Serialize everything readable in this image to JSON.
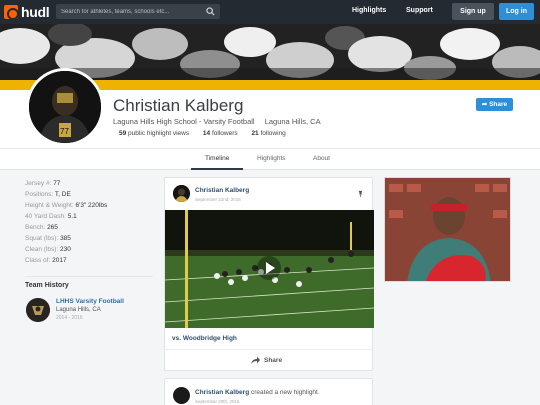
{
  "nav": {
    "logo_text": "hudl",
    "search_placeholder": "Search for athletes, teams, schools etc...",
    "links": [
      "Highlights",
      "Support"
    ],
    "signup_label": "Sign up",
    "login_label": "Log in",
    "brand_color": "#ff6300"
  },
  "profile": {
    "name": "Christian Kalberg",
    "school": "Laguna Hills High School - Varsity Football",
    "location": "Laguna Hills, CA",
    "stats": [
      {
        "value": "59",
        "label": "public highlight views"
      },
      {
        "value": "14",
        "label": "followers"
      },
      {
        "value": "21",
        "label": "following"
      }
    ],
    "share_label": "Share"
  },
  "tabs": [
    {
      "label": "Timeline",
      "active": true
    },
    {
      "label": "Highlights",
      "active": false
    },
    {
      "label": "About",
      "active": false
    }
  ],
  "details": [
    {
      "label": "Jersey #:",
      "value": "77"
    },
    {
      "label": "Positions:",
      "value": "T, DE"
    },
    {
      "label": "Height & Weight:",
      "value": "6'3\" 220lbs"
    },
    {
      "label": "40 Yard Dash:",
      "value": "5.1"
    },
    {
      "label": "Bench:",
      "value": "265"
    },
    {
      "label": "Squat (lbs):",
      "value": "385"
    },
    {
      "label": "Clean (lbs):",
      "value": "230"
    },
    {
      "label": "Class of:",
      "value": "2017"
    }
  ],
  "team_history": {
    "heading": "Team History",
    "team_name": "LHHS Varsity Football",
    "team_location": "Laguna Hills, CA",
    "years": "2014 - 2016"
  },
  "feed": {
    "card1": {
      "author": "Christian Kalberg",
      "date": "September 22nd, 2016",
      "title": "vs. Woodbridge High",
      "share_label": "Share"
    },
    "card2": {
      "author": "Christian Kalberg",
      "action": "created a new highlight.",
      "date": "September 20th, 2016"
    }
  }
}
